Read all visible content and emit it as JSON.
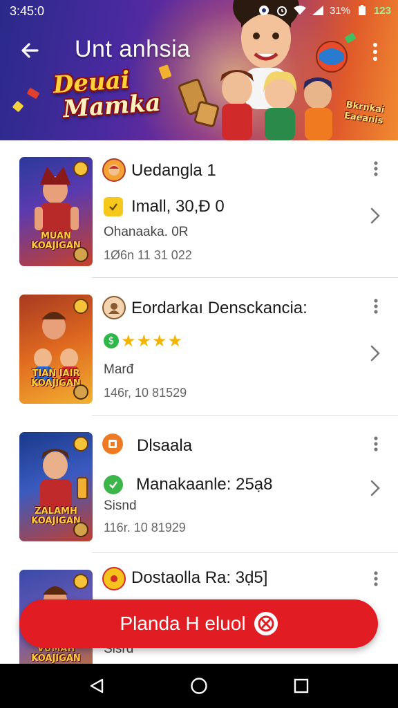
{
  "status_bar": {
    "time": "3:45:0",
    "battery": "31%",
    "extra": "123",
    "icons": [
      "notification-icon",
      "alarm-icon",
      "wifi-icon",
      "signal-icon",
      "battery-icon"
    ]
  },
  "header": {
    "title": "Unt anhsia",
    "logo_line1": "Deuai",
    "logo_line2": "Mamka",
    "side_logo_line1": "Bkrnkai",
    "side_logo_line2": "Eaeanis",
    "back_icon": "arrow-left-icon",
    "menu_icon": "more-vert-icon"
  },
  "items": [
    {
      "title": "Uedangla 1",
      "meta": "Imall, 30,Đ 0",
      "sub": "Ohanaaka. 0R",
      "date": "1Ø6n 11 31 022",
      "thumb_text": "MUAN KOAJIGAN",
      "colors": [
        "#2a3a9a",
        "#c8402a"
      ]
    },
    {
      "title": "Eordarkaı Densckancia:",
      "rating": 4,
      "sub": "Marđ",
      "date": "146r, 10 81529",
      "thumb_text": "TIAN IAIR KOAJIGAN",
      "colors": [
        "#a83a20",
        "#f2b030"
      ]
    },
    {
      "title": "Dlsaala",
      "meta": "Manakaanle: 25ạ8",
      "sub": "Sisnd",
      "date": "116r. 10 81929",
      "thumb_text": "ZALAMH KOAJIGAN",
      "colors": [
        "#1a3a8a",
        "#c04030"
      ]
    },
    {
      "title": "Dostaolla Ra: 3ḍ5]",
      "sub": "Sisrd",
      "thumb_text": "VUMAH KOAJIGAN",
      "colors": [
        "#3a4aa8",
        "#c87030"
      ]
    }
  ],
  "fab": {
    "label": "Planda H eluol",
    "icon": "cancel-icon"
  },
  "nav": {
    "back": "nav-back-icon",
    "home": "nav-home-icon",
    "recents": "nav-recents-icon"
  },
  "colors": {
    "accent_red": "#e21c23",
    "header_start": "#2a2a8a",
    "header_end": "#f08a30"
  }
}
